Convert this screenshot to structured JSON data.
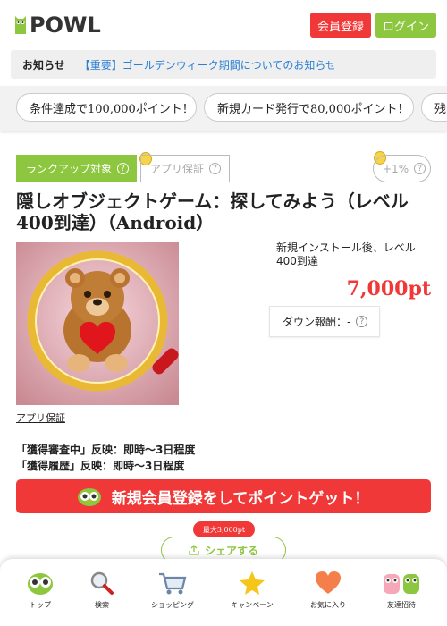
{
  "header": {
    "logo_text": "POWL",
    "register_label": "会員登録",
    "login_label": "ログイン"
  },
  "notice": {
    "label": "お知らせ",
    "link": "【重要】ゴールデンウィーク期間についてのお知らせ"
  },
  "campaigns": [
    {
      "label": "条件達成で100,000ポイント！"
    },
    {
      "label": "新規カード発行で80,000ポイント！"
    },
    {
      "label": "残"
    }
  ],
  "tags": {
    "rank_up": "ランクアップ対象",
    "app_guarantee": "アプリ保証",
    "bonus": "+1%"
  },
  "offer": {
    "title": "隠しオブジェクトゲーム：探してみよう（レベル400到達）（Android）",
    "condition": "新規インストール後、レベル400到達",
    "points": "7,000pt",
    "down_reward": "ダウン報酬：-",
    "thumb_caption": "アプリ保証",
    "reflect_lines": [
      "「獲得審査中」反映：即時～3日程度",
      "「獲得履歴」反映：即時～3日程度"
    ]
  },
  "cta": {
    "label": "新規会員登録をしてポイントゲット！"
  },
  "share": {
    "badge": "最大3,000pt",
    "label": "シェアする"
  },
  "bottom_nav": [
    {
      "label": "トップ",
      "icon": "owl-icon"
    },
    {
      "label": "検索",
      "icon": "search-icon"
    },
    {
      "label": "ショッピング",
      "icon": "cart-icon"
    },
    {
      "label": "キャンペーン",
      "icon": "star-icon"
    },
    {
      "label": "お気に入り",
      "icon": "heart-icon"
    },
    {
      "label": "友達招待",
      "icon": "friends-icon"
    }
  ],
  "colors": {
    "accent_red": "#f03838",
    "accent_green": "#8dc63f",
    "link_blue": "#2b7fd4"
  }
}
